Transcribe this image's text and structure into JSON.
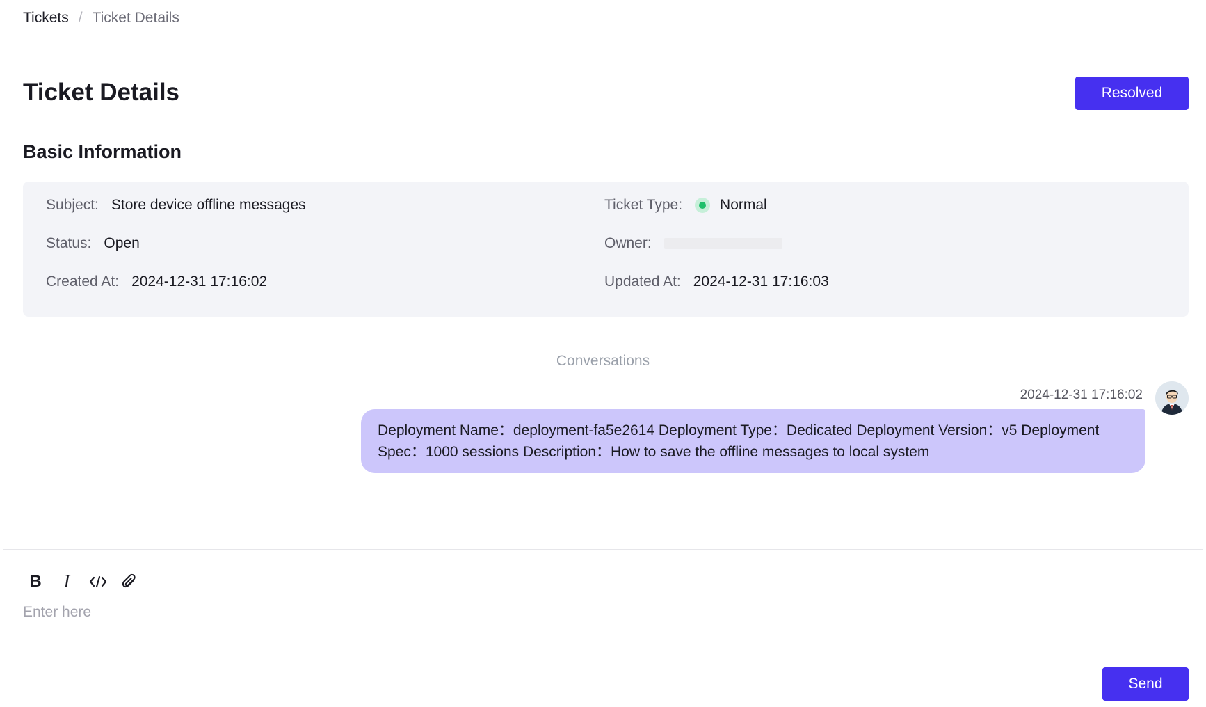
{
  "breadcrumb": {
    "root": "Tickets",
    "separator": "/",
    "current": "Ticket Details"
  },
  "header": {
    "title": "Ticket Details",
    "resolved_label": "Resolved"
  },
  "basic_info": {
    "title": "Basic Information",
    "subject_label": "Subject:",
    "subject_value": "Store device offline messages",
    "ticket_type_label": "Ticket Type:",
    "ticket_type_value": "Normal",
    "status_label": "Status:",
    "status_value": "Open",
    "owner_label": "Owner:",
    "created_label": "Created At:",
    "created_value": "2024-12-31 17:16:02",
    "updated_label": "Updated At:",
    "updated_value": "2024-12-31 17:16:03"
  },
  "conversation": {
    "label": "Conversations",
    "messages": [
      {
        "time": "2024-12-31 17:16:02",
        "text": "Deployment Name：deployment-fa5e2614 Deployment Type：Dedicated Deployment Version：v5 Deployment Spec：1000 sessions Description：How to save the offline messages to local system"
      }
    ]
  },
  "editor": {
    "toolbar": {
      "bold": "B",
      "italic": "I"
    },
    "placeholder": "Enter here",
    "send_label": "Send"
  },
  "colors": {
    "accent": "#4630f0",
    "bubble": "#ccc6fb",
    "panel": "#f3f4f8",
    "status_dot": "#1fbf6b"
  }
}
